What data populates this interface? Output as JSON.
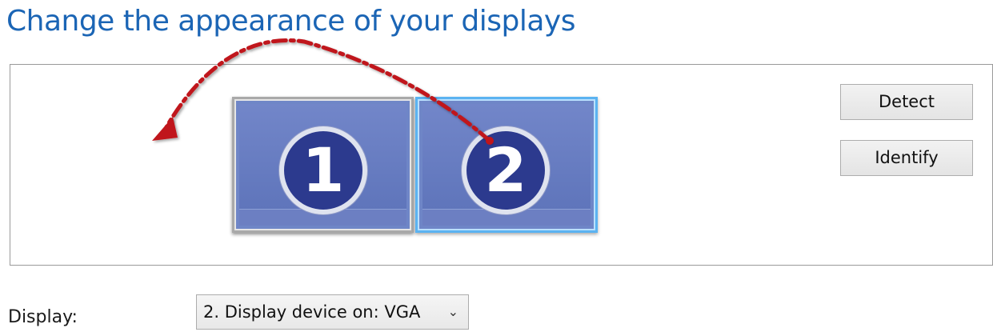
{
  "page": {
    "title": "Change the appearance of your displays"
  },
  "arrangement": {
    "monitors": [
      {
        "number": "1",
        "selected": false
      },
      {
        "number": "2",
        "selected": true
      }
    ],
    "detect_label": "Detect",
    "identify_label": "Identify",
    "annotation": {
      "type": "dashed-arrow",
      "color": "#c0151a",
      "from": "monitor-2",
      "to": "left-of-monitor-1"
    }
  },
  "display_setting": {
    "label": "Display:",
    "selected_value": "2. Display device on: VGA",
    "chevron_icon": "chevron-down-icon"
  },
  "colors": {
    "title": "#1b65b5",
    "monitor_selected_border": "#5bb3f1",
    "badge": "#2c3a8e"
  }
}
